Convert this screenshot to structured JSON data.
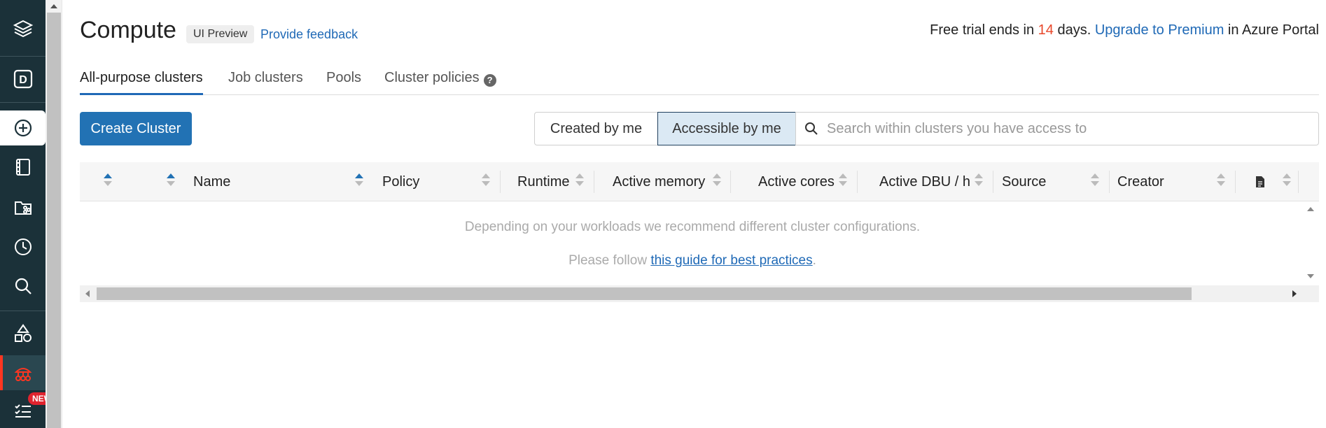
{
  "sidebar": {
    "items": [
      {
        "icon": "layers-logo-icon"
      },
      {
        "icon": "workspace-d-icon",
        "letter": "D"
      },
      {
        "icon": "create-plus-icon"
      },
      {
        "icon": "notebook-icon"
      },
      {
        "icon": "repos-folder-icon"
      },
      {
        "icon": "recents-clock-icon"
      },
      {
        "icon": "search-icon"
      },
      {
        "icon": "data-shapes-icon"
      },
      {
        "icon": "compute-cluster-icon"
      },
      {
        "icon": "jobs-checklist-icon"
      }
    ],
    "new_badge": "NEW"
  },
  "header": {
    "title": "Compute",
    "preview_badge": "UI Preview",
    "feedback_link": "Provide feedback",
    "trial_prefix": "Free trial ends in ",
    "trial_days": "14",
    "trial_mid": " days. ",
    "trial_link": "Upgrade to Premium",
    "trial_suffix": " in Azure Portal"
  },
  "tabs": [
    {
      "label": "All-purpose clusters",
      "active": true
    },
    {
      "label": "Job clusters",
      "active": false
    },
    {
      "label": "Pools",
      "active": false
    },
    {
      "label": "Cluster policies",
      "active": false
    }
  ],
  "toolbar": {
    "create_label": "Create Cluster",
    "filter_created": "Created by me",
    "filter_accessible": "Accessible by me",
    "search_placeholder": "Search within clusters you have access to"
  },
  "table": {
    "columns": [
      "",
      "",
      "Name",
      "Policy",
      "Runtime",
      "Active memory",
      "Active cores",
      "Active DBU / h",
      "Source",
      "Creator",
      ""
    ],
    "empty_line1": "Depending on your workloads we recommend different cluster configurations.",
    "empty_line2_prefix": "Please follow ",
    "empty_line2_link": "this guide for best practices",
    "empty_line2_suffix": "."
  },
  "colors": {
    "sidebar_bg": "#1b3139",
    "accent_blue": "#2272b4",
    "link_blue": "#1f69b6",
    "active_red": "#ff3621",
    "days_orange": "#e8472a"
  }
}
